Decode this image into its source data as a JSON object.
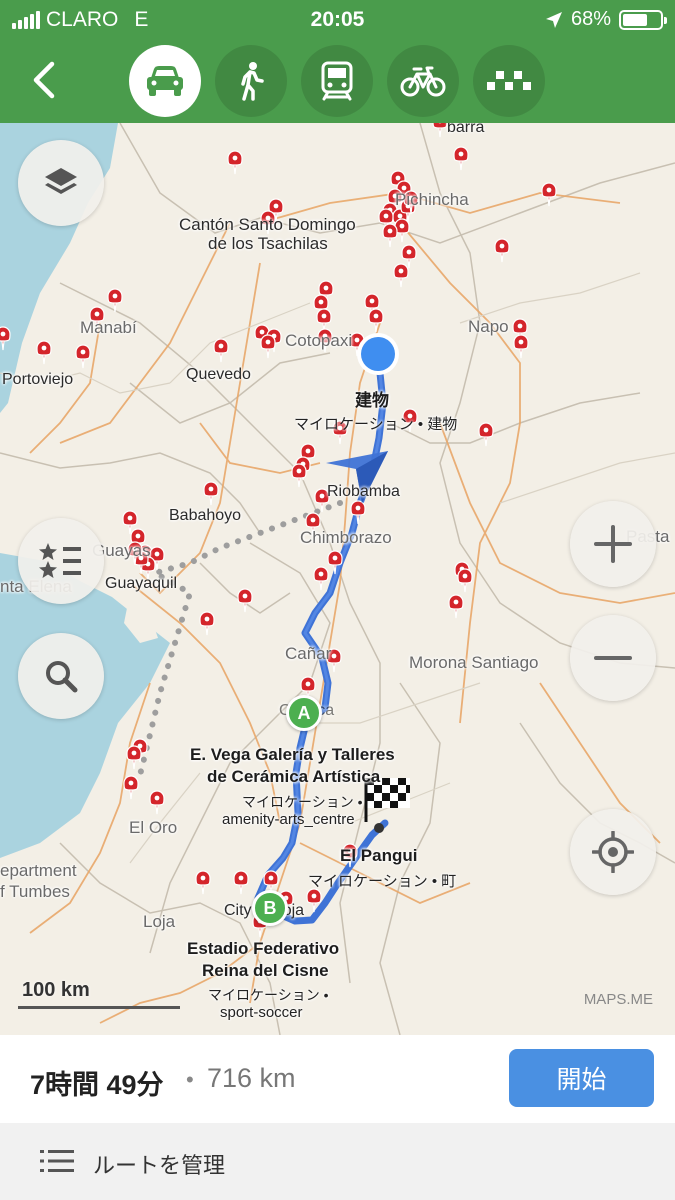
{
  "status_bar": {
    "carrier": "CLARO",
    "network": "E",
    "time": "20:05",
    "battery": "68%",
    "battery_level": 0.68,
    "icons": [
      "signal-icon",
      "location-arrow-icon",
      "battery-icon"
    ]
  },
  "route_modes": {
    "selected": "car",
    "items": [
      {
        "mode": "car",
        "icon": "car-icon"
      },
      {
        "mode": "walk",
        "icon": "pedestrian-icon"
      },
      {
        "mode": "transit",
        "icon": "train-icon"
      },
      {
        "mode": "bicycle",
        "icon": "bicycle-icon"
      },
      {
        "mode": "taxi",
        "icon": "taxi-icon"
      }
    ]
  },
  "map": {
    "labels": {
      "ibarra": "barra",
      "pichincha": "Pichincha",
      "santo_domingo_1": "Cantón Santo Domingo",
      "santo_domingo_2": "de los Tsachilas",
      "manabi": "Manabí",
      "portoviejo": "Portoviejo",
      "quevedo": "Quevedo",
      "cotopaxi": "Cotopaxi",
      "napo": "Napo",
      "riobamba": "Riobamba",
      "babahoyo": "Babahoyo",
      "chimborazo": "Chimborazo",
      "guayas": "Guayas",
      "guayaquil": "Guayaquil",
      "santa_elena": "nta Elena",
      "pastaza": "Pasta",
      "canar": "Cañar",
      "morona": "Morona Santiago",
      "cuenca": "Cuenca",
      "el_oro": "El Oro",
      "tumbes_1": "epartment",
      "tumbes_2": "f Tumbes",
      "loja": "Loja",
      "city_of_loja": "City of Loja",
      "el_pangui": "El Pangui",
      "el_pangui_sub": "マイロケーション • 町"
    },
    "points": {
      "start_title": "建物",
      "start_sub": "マイロケーション • 建物",
      "a_title_1": "E. Vega Galería y Talleres",
      "a_title_2": "de Cerámica Artística",
      "a_sub_1": "マイロケーション •",
      "a_sub_2": "amenity-arts_centre",
      "b_title_1": "Estadio Federativo",
      "b_title_2": "Reina del Cisne",
      "b_sub_1": "マイロケーション •",
      "b_sub_2": "sport-soccer",
      "marker_a": "A",
      "marker_b": "B"
    },
    "scale_label": "100 km",
    "attribution": "MAPS.ME",
    "colors": {
      "route": "#3f73d6",
      "pin": "#d4252b",
      "header": "#4a9c4c",
      "water": "#aad3df"
    }
  },
  "summary": {
    "duration": "7時間 49分",
    "separator": "•",
    "distance": "716 km",
    "start_label": "開始"
  },
  "manage": {
    "label": "ルートを管理"
  }
}
